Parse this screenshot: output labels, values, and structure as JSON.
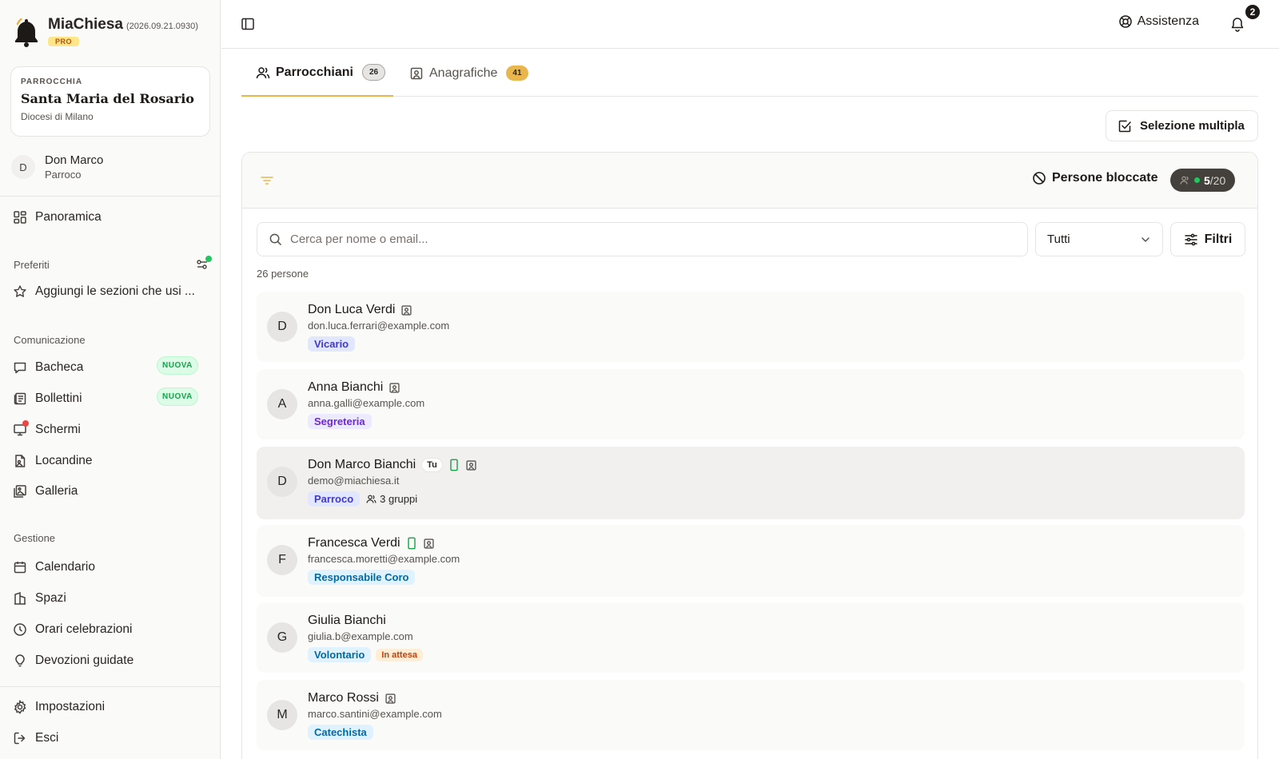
{
  "brand": {
    "name": "MiaChiesa",
    "version": "(2026.09.21.0930)",
    "plan": "PRO"
  },
  "parish": {
    "kicker": "PARROCCHIA",
    "name": "Santa Maria del Rosario",
    "diocese": "Diocesi di Milano"
  },
  "user": {
    "initial": "D",
    "name": "Don Marco",
    "role": "Parroco"
  },
  "sidebar": {
    "overview": "Panoramica",
    "favorites": {
      "title": "Preferiti",
      "empty": "Aggiungi le sezioni che usi ..."
    },
    "communication": {
      "title": "Comunicazione",
      "items": [
        {
          "label": "Bacheca",
          "badge": "NUOVA"
        },
        {
          "label": "Bollettini",
          "badge": "NUOVA"
        },
        {
          "label": "Schermi"
        },
        {
          "label": "Locandine"
        },
        {
          "label": "Galleria"
        }
      ]
    },
    "management": {
      "title": "Gestione",
      "items": [
        {
          "label": "Calendario"
        },
        {
          "label": "Spazi"
        },
        {
          "label": "Orari celebrazioni"
        },
        {
          "label": "Devozioni guidate"
        }
      ]
    },
    "footer": [
      {
        "label": "Impostazioni"
      },
      {
        "label": "Esci"
      }
    ]
  },
  "header": {
    "assist": "Assistenza",
    "notifications": "2"
  },
  "tabs": [
    {
      "label": "Parrocchiani",
      "count": "26"
    },
    {
      "label": "Anagrafiche",
      "count": "41"
    }
  ],
  "toolbar": {
    "multi_select": "Selezione multipla"
  },
  "panel": {
    "blocked_label": "Persone bloccate",
    "quota_used": "5",
    "quota_total": "/20",
    "search_placeholder": "Cerca per nome o email...",
    "filter_select": "Tutti",
    "filters_label": "Filtri",
    "count_text": "26 persone"
  },
  "people": [
    {
      "initial": "D",
      "name": "Don Luca Verdi",
      "email": "don.luca.ferrari@example.com",
      "role": "Vicario"
    },
    {
      "initial": "A",
      "name": "Anna Bianchi",
      "email": "anna.galli@example.com",
      "role": "Segreteria"
    },
    {
      "initial": "D",
      "name": "Don Marco Bianchi",
      "you": "Tu",
      "email": "demo@miachiesa.it",
      "role": "Parroco",
      "groups": "3 gruppi"
    },
    {
      "initial": "F",
      "name": "Francesca Verdi",
      "email": "francesca.moretti@example.com",
      "role": "Responsabile Coro"
    },
    {
      "initial": "G",
      "name": "Giulia Bianchi",
      "email": "giulia.b@example.com",
      "role": "Volontario",
      "status": "In attesa"
    },
    {
      "initial": "M",
      "name": "Marco Rossi",
      "email": "marco.santini@example.com",
      "role": "Catechista"
    }
  ],
  "colors": {
    "accent": "#e8b64c",
    "online": "#22c55e",
    "alert": "#ef4444",
    "dark": "#44403c"
  }
}
